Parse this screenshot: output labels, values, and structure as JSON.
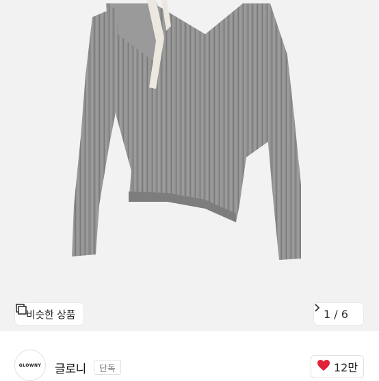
{
  "product": {
    "image_subject": "grey ribbed knit asymmetric long-sleeve top",
    "pager": {
      "current": 1,
      "total": 6,
      "text": "1 / 6"
    }
  },
  "similar_button": {
    "label": "비슷한 상품",
    "icon": "similar-products-icon"
  },
  "brand": {
    "logo_text": "GLOWNY",
    "name": "글로니",
    "tag": "단독"
  },
  "like": {
    "count_text": "12만",
    "icon": "heart-icon",
    "color": "#e0223a"
  },
  "colors": {
    "hero_bg": "#f2f2f2",
    "knit": "#8d8d8d",
    "strap": "#ece8df"
  }
}
